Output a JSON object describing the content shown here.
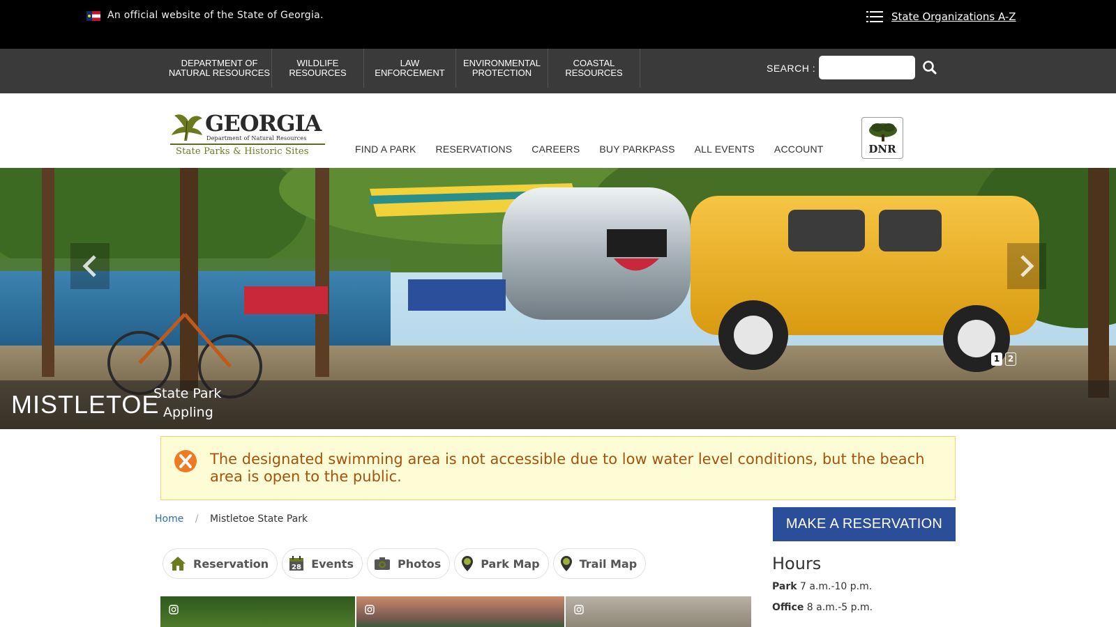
{
  "official_bar": {
    "text": "An official website of the State of Georgia.",
    "orgs_link": "State Organizations A-Z"
  },
  "agency_nav": [
    {
      "line1": "DEPARTMENT OF",
      "line2": "NATURAL RESOURCES"
    },
    {
      "line1": "WILDLIFE",
      "line2": "RESOURCES"
    },
    {
      "line1": "LAW",
      "line2": "ENFORCEMENT"
    },
    {
      "line1": "ENVIRONMENTAL",
      "line2": "PROTECTION"
    },
    {
      "line1": "COASTAL",
      "line2": "RESOURCES"
    }
  ],
  "search": {
    "label": "SEARCH :",
    "placeholder": ""
  },
  "logo": {
    "title": "GEORGIA",
    "subtitle": "Department of Natural Resources",
    "tagline": "State Parks & Historic Sites"
  },
  "main_nav": [
    "FIND A PARK",
    "RESERVATIONS",
    "CAREERS",
    "BUY PARKPASS",
    "ALL EVENTS",
    "ACCOUNT"
  ],
  "dnr_badge": "DNR",
  "hero": {
    "park_name": "MISTLETOE",
    "park_type": "State Park",
    "county": "Appling",
    "pages": [
      "1",
      "2"
    ],
    "active_page": 1
  },
  "alert": {
    "message": "The designated swimming area is not accessible due to low water level conditions, but the beach area is open to the public."
  },
  "breadcrumb": {
    "home": "Home",
    "separator": "/",
    "current": "Mistletoe State Park"
  },
  "quick_links": [
    {
      "label": "Reservation",
      "icon": "home-icon"
    },
    {
      "label": "Events",
      "icon": "calendar-icon",
      "badge": "28"
    },
    {
      "label": "Photos",
      "icon": "camera-icon"
    },
    {
      "label": "Park Map",
      "icon": "map-pin-icon"
    },
    {
      "label": "Trail Map",
      "icon": "map-pin-icon"
    }
  ],
  "sidebar": {
    "reserve_label": "MAKE A RESERVATION",
    "hours_title": "Hours",
    "hours": [
      {
        "label": "Park",
        "value": "7 a.m.-10 p.m."
      },
      {
        "label": "Office",
        "value": "8 a.m.-5 p.m."
      }
    ]
  },
  "colors": {
    "official_bar": "#000000",
    "agency_bar": "#3a3a3a",
    "reserve_button": "#2b4e9b",
    "alert_bg": "#fefcd5",
    "alert_text": "#a2530f",
    "link": "#2c6fb3"
  }
}
